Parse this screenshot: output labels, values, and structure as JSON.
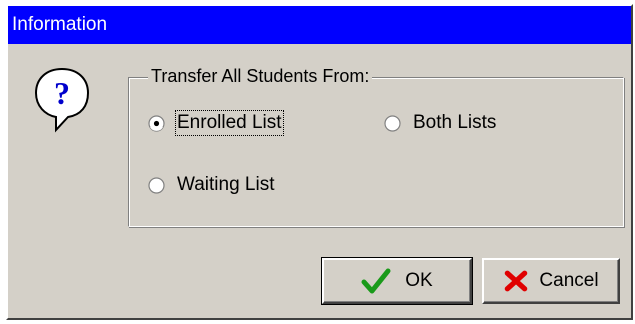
{
  "window": {
    "title": "Information"
  },
  "icon": {
    "name": "question-icon",
    "glyph": "?"
  },
  "group": {
    "legend": "Transfer All Students From:",
    "options": [
      {
        "label": "Enrolled List",
        "selected": true
      },
      {
        "label": "Both Lists",
        "selected": false
      },
      {
        "label": "Waiting List",
        "selected": false
      }
    ]
  },
  "buttons": {
    "ok": {
      "label": "OK",
      "icon": "checkmark-icon"
    },
    "cancel": {
      "label": "Cancel",
      "icon": "x-icon"
    }
  },
  "colors": {
    "titlebar": "#0000ff",
    "dialog": "#d4d0c8",
    "ok_check": "#1a9a1a",
    "cancel_x": "#e00000"
  }
}
